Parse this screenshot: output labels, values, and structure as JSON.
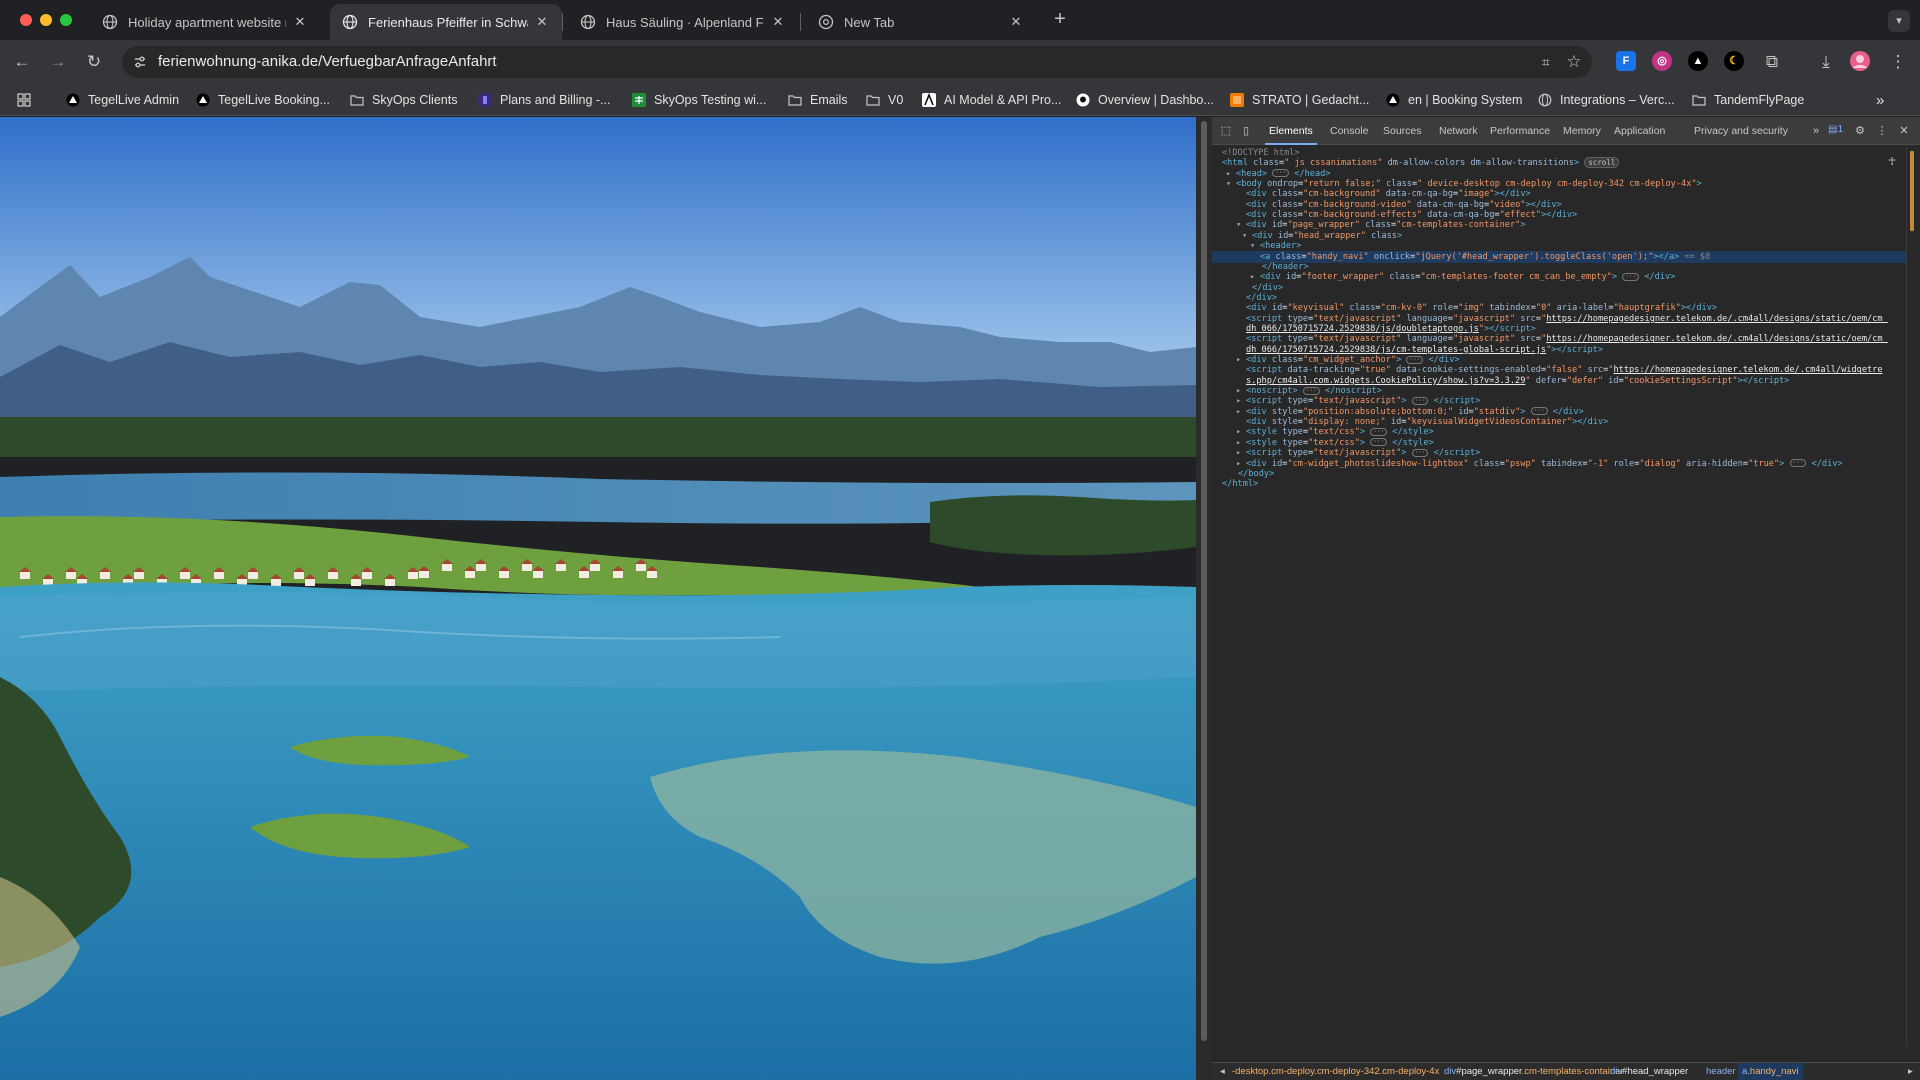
{
  "window": {
    "traffic_lights": [
      "#ff5f57",
      "#febc2e",
      "#28c840"
    ]
  },
  "tabs": [
    {
      "title": "Holiday apartment website re",
      "icon": "globe-icon",
      "active": false
    },
    {
      "title": "Ferienhaus Pfeiffer in Schwan",
      "icon": "globe-icon",
      "active": true
    },
    {
      "title": "Haus Säuling · Alpenland Feri",
      "icon": "globe-icon",
      "active": false
    },
    {
      "title": "New Tab",
      "icon": "chrome-icon",
      "active": false
    }
  ],
  "tab_close_glyph": "✕",
  "new_tab_glyph": "+",
  "address_bar": {
    "url": "ferienwohnung-anika.de/VerfuegbarAnfrageAnfahrt"
  },
  "toolbar_glyphs": {
    "back": "←",
    "forward": "→",
    "reload": "↻",
    "translate": "⌗",
    "star": "☆",
    "puzzle": "⧉",
    "download": "⤓",
    "menu": "⋮"
  },
  "extensions": [
    {
      "label": "F",
      "bg": "#1a73e8",
      "fg": "#ffffff"
    },
    {
      "label": "◎",
      "bg": "#c13584",
      "fg": "#ffffff"
    },
    {
      "label": "▲",
      "bg": "#000000",
      "fg": "#ffffff"
    },
    {
      "label": "☾",
      "bg": "#000000",
      "fg": "#f4c430"
    }
  ],
  "bookmarks": [
    {
      "label": "TegelLive Admin",
      "icon": "triangle-icon"
    },
    {
      "label": "TegelLive Booking...",
      "icon": "triangle-icon"
    },
    {
      "label": "SkyOps Clients",
      "icon": "folder-icon"
    },
    {
      "label": "Plans and Billing -...",
      "icon": "stripe-icon"
    },
    {
      "label": "SkyOps Testing wi...",
      "icon": "sheets-icon"
    },
    {
      "label": "Emails",
      "icon": "folder-icon"
    },
    {
      "label": "V0",
      "icon": "folder-icon"
    },
    {
      "label": "AI Model & API Pro...",
      "icon": "logo-a-icon"
    },
    {
      "label": "Overview | Dashbo...",
      "icon": "github-icon"
    },
    {
      "label": "STRATO | Gedacht...",
      "icon": "strato-icon"
    },
    {
      "label": "en | Booking System",
      "icon": "triangle-icon"
    },
    {
      "label": "Integrations – Verc...",
      "icon": "globe-icon"
    },
    {
      "label": "TandemFlyPage",
      "icon": "folder-icon"
    }
  ],
  "bookmarks_overflow": "»",
  "photo": {
    "colors": {
      "sky_top": "#2f6fc9",
      "sky_bottom": "#b6d6f2",
      "mountains_far": "#5f86b0",
      "mountains_near": "#3f5f86",
      "forest": "#2d4a2a",
      "meadow": "#6fa040",
      "lake_deep": "#1b6fa6",
      "lake_light": "#3fa1c6",
      "shallows": "#8fb6a0"
    }
  },
  "devtools": {
    "tabs": [
      "Elements",
      "Console",
      "Sources",
      "Network",
      "Performance",
      "Memory",
      "Application",
      "Privacy and security"
    ],
    "active_tab": "Elements",
    "overflow": "»",
    "issues_count": "1",
    "dom_lines": [
      {
        "html": "<span class='cm'>&lt;!DOCTYPE html&gt;</span>"
      },
      {
        "html": "<span class='tg'>&lt;html</span> <span class='at'>class</span>=<span class='av'>\" js cssanimations\"</span> <span class='at'>dm-allow-colors dm-allow-transitions</span><span class='tg'>&gt;</span> <span class='badge'>scroll</span>"
      },
      {
        "html": "<span class='tri'>▸</span><span class='tg'>&lt;head&gt;</span> <span class='ell'>···</span> <span class='tg'>&lt;/head&gt;</span>"
      },
      {
        "html": "<span class='tri'>▾</span><span class='tg'>&lt;body</span> <span class='at'>ondrop</span>=<span class='av'>\"return false;\"</span> <span class='at'>class</span>=<span class='av'>\" device-desktop cm-deploy cm-deploy-342 cm-deploy-4x\"</span><span class='tg'>&gt;</span>"
      },
      {
        "html": "<span class='tri'></span><span class='tg'>&lt;div</span> <span class='at'>class</span>=<span class='av'>\"cm-background\"</span> <span class='at'>data-cm-qa-bg</span>=<span class='av'>\"image\"</span><span class='tg'>&gt;&lt;/div&gt;</span>"
      },
      {
        "html": "<span class='tri'></span><span class='tg'>&lt;div</span> <span class='at'>class</span>=<span class='av'>\"cm-background-video\"</span> <span class='at'>data-cm-qa-bg</span>=<span class='av'>\"video\"</span><span class='tg'>&gt;&lt;/div&gt;</span>"
      },
      {
        "html": "<span class='tri'></span><span class='tg'>&lt;div</span> <span class='at'>class</span>=<span class='av'>\"cm-background-effects\"</span> <span class='at'>data-cm-qa-bg</span>=<span class='av'>\"effect\"</span><span class='tg'>&gt;&lt;/div&gt;</span>"
      },
      {
        "html": "<span class='tri'>▾</span><span class='tg'>&lt;div</span> <span class='at'>id</span>=<span class='av'>\"page_wrapper\"</span> <span class='at'>class</span>=<span class='av'>\"cm-templates-container\"</span><span class='tg'>&gt;</span>"
      },
      {
        "html": "<span class='tri'>▾</span><span class='tg'>&lt;div</span> <span class='at'>id</span>=<span class='av'>\"head_wrapper\"</span> <span class='at'>class</span><span class='tg'>&gt;</span>"
      },
      {
        "html": "<span class='tri'>▾</span><span class='tg'>&lt;header&gt;</span>"
      },
      {
        "html": "<span class='tg'>&lt;a</span> <span class='at'>class</span>=<span class='av'>\"handy_navi\"</span> <span class='at'>onclick</span>=<span class='av'>\"jQuery('#head_wrapper').toggleClass('open');\"</span><span class='tg'>&gt;&lt;/a&gt;</span> <span class='cm'>== $0</span>",
        "selected": true
      },
      {
        "html": "<span class='tri'></span><span class='tg'>&lt;/header&gt;</span>"
      },
      {
        "html": "<span class='tri'>▸</span><span class='tg'>&lt;div</span> <span class='at'>id</span>=<span class='av'>\"footer_wrapper\"</span> <span class='at'>class</span>=<span class='av'>\"cm-templates-footer cm_can_be_empty\"</span><span class='tg'>&gt;</span> <span class='ell'>···</span> <span class='tg'>&lt;/div&gt;</span>"
      },
      {
        "html": "<span class='tri'></span><span class='tg'>&lt;/div&gt;</span>"
      },
      {
        "html": "<span class='tri'></span><span class='tg'>&lt;/div&gt;</span>"
      },
      {
        "html": "<span class='tri'></span><span class='tg'>&lt;div</span> <span class='at'>id</span>=<span class='av'>\"keyvisual\"</span> <span class='at'>class</span>=<span class='av'>\"cm-kv-0\"</span> <span class='at'>role</span>=<span class='av'>\"img\"</span> <span class='at'>tabindex</span>=<span class='av'>\"0\"</span> <span class='at'>aria-label</span>=<span class='av'>\"hauptgrafik\"</span><span class='tg'>&gt;&lt;/div&gt;</span>"
      },
      {
        "html": "<span class='tri'></span><span class='tg'>&lt;script</span> <span class='at'>type</span>=<span class='av'>\"text/javascript\"</span> <span class='at'>language</span>=<span class='av'>\"javascript\"</span> <span class='at'>src</span>=<span class='av'>\"</span><span class='lk'>https://homepagedesigner.telekom.de/.cm4all/designs/static/oem/cm_</span>"
      },
      {
        "html": "<span class='tri'></span><span class='lk'>dh_066/1750715724.2529838/js/doubletaptogo.js</span><span class='av'>\"</span><span class='tg'>&gt;&lt;/script&gt;</span>"
      },
      {
        "html": "<span class='tri'></span><span class='tg'>&lt;script</span> <span class='at'>type</span>=<span class='av'>\"text/javascript\"</span> <span class='at'>language</span>=<span class='av'>\"javascript\"</span> <span class='at'>src</span>=<span class='av'>\"</span><span class='lk'>https://homepagedesigner.telekom.de/.cm4all/designs/static/oem/cm_</span>"
      },
      {
        "html": "<span class='tri'></span><span class='lk'>dh_066/1750715724.2529838/js/cm-templates-global-script.js</span><span class='av'>\"</span><span class='tg'>&gt;&lt;/script&gt;</span>"
      },
      {
        "html": "<span class='tri'>▸</span><span class='tg'>&lt;div</span> <span class='at'>class</span>=<span class='av'>\"cm_widget_anchor\"</span><span class='tg'>&gt;</span> <span class='ell'>···</span> <span class='tg'>&lt;/div&gt;</span>"
      },
      {
        "html": "<span class='tri'></span><span class='tg'>&lt;script</span> <span class='at'>data-tracking</span>=<span class='av'>\"true\"</span> <span class='at'>data-cookie-settings-enabled</span>=<span class='av'>\"false\"</span> <span class='at'>src</span>=<span class='av'>\"</span><span class='lk'>https://homepagedesigner.telekom.de/.cm4all/widgetre</span>"
      },
      {
        "html": "<span class='tri'></span><span class='lk'>s.php/cm4all.com.widgets.CookiePolicy/show.js?v=3.3.29</span><span class='av'>\"</span> <span class='at'>defer</span>=<span class='av'>\"defer\"</span> <span class='at'>id</span>=<span class='av'>\"cookieSettingsScript\"</span><span class='tg'>&gt;&lt;/script&gt;</span>"
      },
      {
        "html": "<span class='tri'>▸</span><span class='tg'>&lt;noscript&gt;</span> <span class='ell'>···</span> <span class='tg'>&lt;/noscript&gt;</span>"
      },
      {
        "html": "<span class='tri'>▸</span><span class='tg'>&lt;script</span> <span class='at'>type</span>=<span class='av'>\"text/javascript\"</span><span class='tg'>&gt;</span> <span class='ell'>···</span> <span class='tg'>&lt;/script&gt;</span>"
      },
      {
        "html": "<span class='tri'>▸</span><span class='tg'>&lt;div</span> <span class='at'>style</span>=<span class='av'>\"position:absolute;bottom:0;\"</span> <span class='at'>id</span>=<span class='av'>\"statdiv\"</span><span class='tg'>&gt;</span> <span class='ell'>···</span> <span class='tg'>&lt;/div&gt;</span>"
      },
      {
        "html": "<span class='tri'></span><span class='tg'>&lt;div</span> <span class='at'>style</span>=<span class='av'>\"display: none;\"</span> <span class='at'>id</span>=<span class='av'>\"keyvisualWidgetVideosContainer\"</span><span class='tg'>&gt;&lt;/div&gt;</span>"
      },
      {
        "html": "<span class='tri'>▸</span><span class='tg'>&lt;style</span> <span class='at'>type</span>=<span class='av'>\"text/css\"</span><span class='tg'>&gt;</span> <span class='ell'>···</span> <span class='tg'>&lt;/style&gt;</span>"
      },
      {
        "html": "<span class='tri'>▸</span><span class='tg'>&lt;style</span> <span class='at'>type</span>=<span class='av'>\"text/css\"</span><span class='tg'>&gt;</span> <span class='ell'>···</span> <span class='tg'>&lt;/style&gt;</span>"
      },
      {
        "html": "<span class='tri'>▸</span><span class='tg'>&lt;script</span> <span class='at'>type</span>=<span class='av'>\"text/javascript\"</span><span class='tg'>&gt;</span> <span class='ell'>···</span> <span class='tg'>&lt;/script&gt;</span>"
      },
      {
        "html": "<span class='tri'>▸</span><span class='tg'>&lt;div</span> <span class='at'>id</span>=<span class='av'>\"cm-widget_photoslideshow-lightbox\"</span> <span class='at'>class</span>=<span class='av'>\"pswp\"</span> <span class='at'>tabindex</span>=<span class='av'>\"-1\"</span> <span class='at'>role</span>=<span class='av'>\"dialog\"</span> <span class='at'>aria-hidden</span>=<span class='av'>\"true\"</span><span class='tg'>&gt;</span> <span class='ell'>···</span> <span class='tg'>&lt;/div&gt;</span>"
      },
      {
        "html": "<span class='tri'></span><span class='tg'>&lt;/body&gt;</span>"
      },
      {
        "html": "<span class='tg'>&lt;/html&gt;</span>"
      }
    ],
    "breadcrumbs": {
      "arrow_left": "◂",
      "arrow_right": "▸",
      "items": [
        {
          "parts": [
            {
              "t": "-desktop.cm-deploy.cm-deploy-342.cm-deploy-4x",
              "c": "cr-cls"
            }
          ]
        },
        {
          "parts": [
            {
              "t": "div",
              "c": "cr-tag"
            },
            {
              "t": "#page_wrapper",
              "c": "cr-id"
            },
            {
              "t": ".cm-templates-container",
              "c": "cr-cls"
            }
          ]
        },
        {
          "parts": [
            {
              "t": "div",
              "c": "cr-tag"
            },
            {
              "t": "#head_wrapper",
              "c": "cr-id"
            }
          ]
        },
        {
          "parts": [
            {
              "t": "header",
              "c": "cr-tag"
            }
          ]
        },
        {
          "parts": [
            {
              "t": "a",
              "c": "cr-tag"
            },
            {
              "t": ".handy_navi",
              "c": "cr-cls"
            }
          ],
          "selected": true
        }
      ]
    }
  }
}
